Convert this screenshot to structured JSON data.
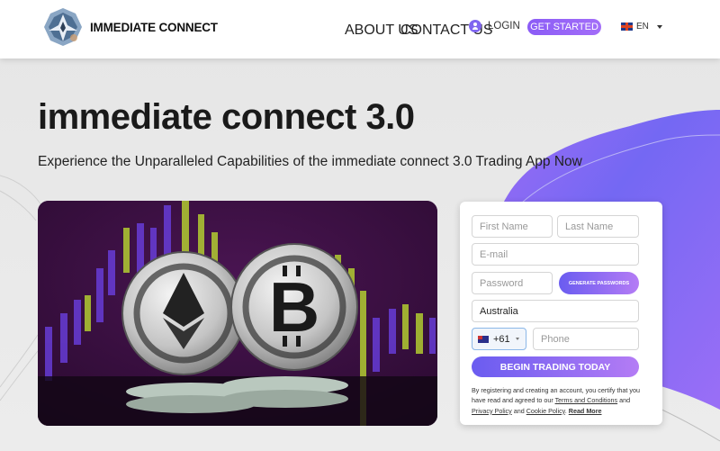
{
  "brand": {
    "name": "IMMEDIATE CONNECT",
    "logo_icon": "crystal-star-logo"
  },
  "nav": {
    "about": "ABOUT US",
    "contact": "CONTACT US",
    "login": "LOGIN",
    "login_icon": "user-circle-icon",
    "get_started": "GET STARTED",
    "language": "EN",
    "language_flag": "uk-flag-icon"
  },
  "hero": {
    "title": "immediate connect 3.0",
    "subtitle": "Experience the Unparalleled Capabilities of the immediate connect 3.0 Trading App Now",
    "image_alt": "Ethereum and Bitcoin silver coins in front of a purple candlestick chart"
  },
  "form": {
    "first_name_placeholder": "First Name",
    "last_name_placeholder": "Last Name",
    "email_placeholder": "E-mail",
    "password_placeholder": "Password",
    "generate_button": "GENERATE PASSWORDS",
    "country_value": "Australia",
    "dial_code": "+61",
    "dial_flag": "australia-flag-icon",
    "phone_placeholder": "Phone",
    "submit_button": "BEGIN TRADING TODAY",
    "legal": {
      "text_1": "By registering and creating an account, you certify that you have read and agreed to our ",
      "terms": "Terms and Conditions",
      "text_2": " and ",
      "privacy": "Privacy Policy",
      "text_3": " and ",
      "cookie": "Cookie Policy",
      "text_4": ". ",
      "read_more": "Read More"
    }
  },
  "colors": {
    "accent_start": "#6a5cf0",
    "accent_end": "#b47cf5",
    "blob": "#7a6af4",
    "background": "#e6e6e6"
  }
}
